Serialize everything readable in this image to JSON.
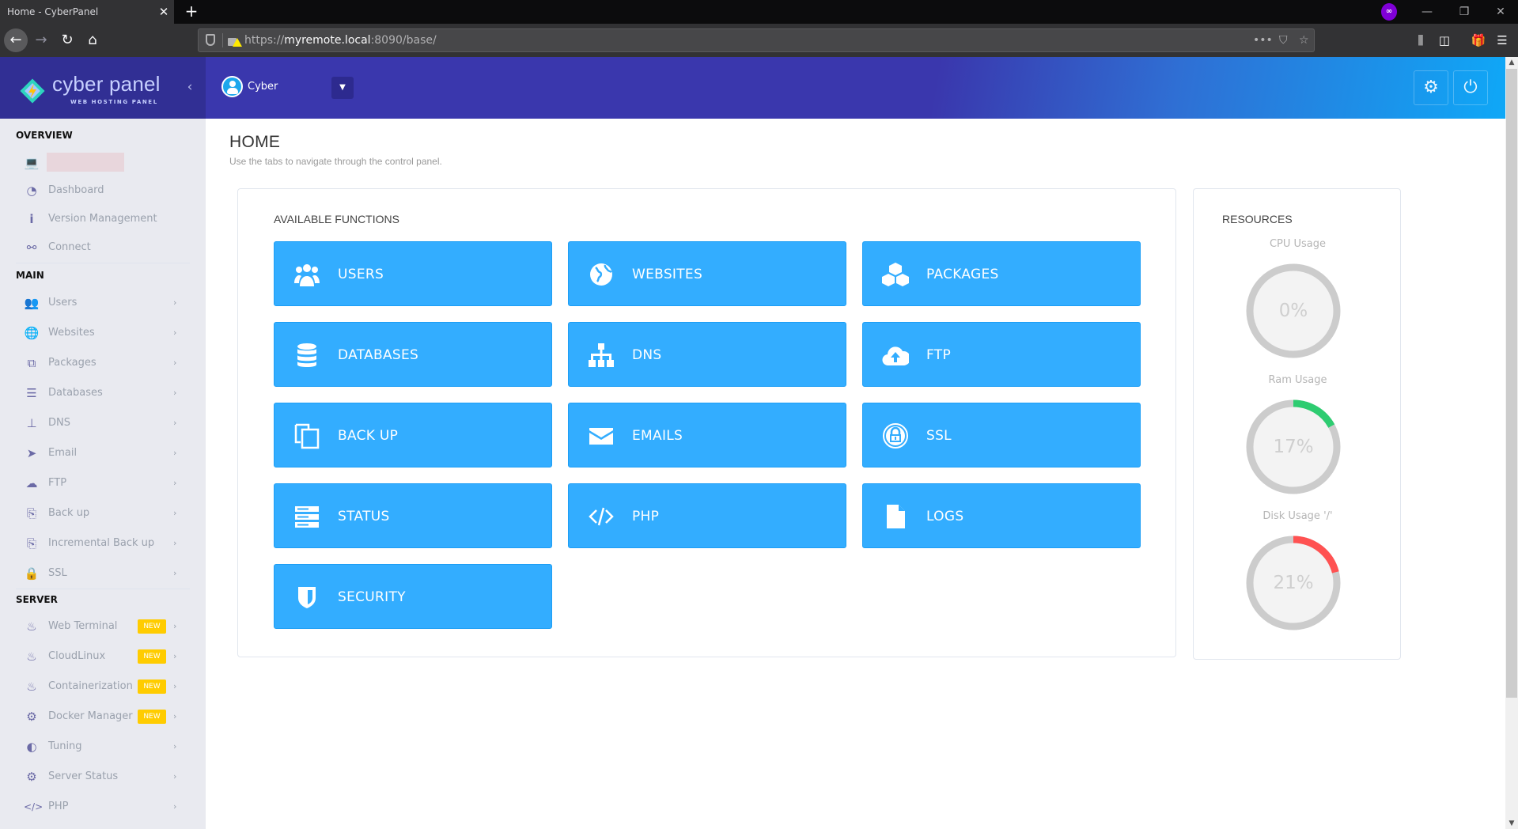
{
  "browser": {
    "tab_title": "Home - CyberPanel",
    "url_prefix": "https://",
    "url_host": "myremote.local",
    "url_suffix": ":8090/base/",
    "icons": [
      "back-icon",
      "forward-icon",
      "reload-icon",
      "home-icon",
      "shield-icon",
      "lock-warning-icon",
      "more-icon",
      "pocket-icon",
      "star-icon",
      "library-icon",
      "sidebar-icon",
      "gift-icon",
      "menu-icon"
    ]
  },
  "header": {
    "logo_text": "cyber panel",
    "logo_sub": "WEB HOSTING PANEL",
    "user_name": "Cyber"
  },
  "sidebar": {
    "sections": [
      {
        "title": "OVERVIEW"
      },
      {
        "title": "MAIN"
      },
      {
        "title": "SERVER"
      }
    ],
    "overview": [
      {
        "label": "",
        "icon": "laptop-icon",
        "redacted": true
      },
      {
        "label": "Dashboard",
        "icon": "dashboard-icon"
      },
      {
        "label": "Version Management",
        "icon": "info-icon"
      },
      {
        "label": "Connect",
        "icon": "link-icon"
      }
    ],
    "main": [
      {
        "label": "Users",
        "icon": "users-icon"
      },
      {
        "label": "Websites",
        "icon": "globe-icon"
      },
      {
        "label": "Packages",
        "icon": "cubes-icon"
      },
      {
        "label": "Databases",
        "icon": "database-icon"
      },
      {
        "label": "DNS",
        "icon": "sitemap-icon"
      },
      {
        "label": "Email",
        "icon": "paper-plane-icon"
      },
      {
        "label": "FTP",
        "icon": "cloud-upload-icon"
      },
      {
        "label": "Back up",
        "icon": "copy-icon"
      },
      {
        "label": "Incremental Back up",
        "icon": "copy-icon"
      },
      {
        "label": "SSL",
        "icon": "lock-icon"
      }
    ],
    "server": [
      {
        "label": "Web Terminal",
        "icon": "fire-icon",
        "badge": "NEW"
      },
      {
        "label": "CloudLinux",
        "icon": "fire-icon",
        "badge": "NEW"
      },
      {
        "label": "Containerization",
        "icon": "fire-icon",
        "badge": "NEW"
      },
      {
        "label": "Docker Manager",
        "icon": "cogs-icon",
        "badge": "NEW"
      },
      {
        "label": "Tuning",
        "icon": "adjust-icon"
      },
      {
        "label": "Server Status",
        "icon": "gear-icon"
      },
      {
        "label": "PHP",
        "icon": "code-icon"
      }
    ]
  },
  "page": {
    "title": "HOME",
    "subtitle": "Use the tabs to navigate through the control panel."
  },
  "functions": {
    "title": "AVAILABLE FUNCTIONS",
    "items": [
      {
        "label": "USERS",
        "icon": "users-icon"
      },
      {
        "label": "WEBSITES",
        "icon": "globe-icon"
      },
      {
        "label": "PACKAGES",
        "icon": "cubes-icon"
      },
      {
        "label": "DATABASES",
        "icon": "database-icon"
      },
      {
        "label": "DNS",
        "icon": "sitemap-icon"
      },
      {
        "label": "FTP",
        "icon": "cloud-upload-icon"
      },
      {
        "label": "BACK UP",
        "icon": "copy-icon"
      },
      {
        "label": "EMAILS",
        "icon": "envelope-icon"
      },
      {
        "label": "SSL",
        "icon": "lock-circle-icon"
      },
      {
        "label": "STATUS",
        "icon": "server-icon"
      },
      {
        "label": "PHP",
        "icon": "code-icon"
      },
      {
        "label": "LOGS",
        "icon": "file-icon"
      },
      {
        "label": "SECURITY",
        "icon": "shield-icon"
      }
    ]
  },
  "resources": {
    "title": "RESOURCES",
    "gauges": [
      {
        "label": "CPU Usage",
        "value": 0,
        "display": "0%",
        "color": "#2ecc71"
      },
      {
        "label": "Ram Usage",
        "value": 17,
        "display": "17%",
        "color": "#2ecc71"
      },
      {
        "label": "Disk Usage '/'",
        "value": 21,
        "display": "21%",
        "color": "#ff5252"
      }
    ]
  },
  "colors": {
    "accent": "#33adff",
    "header": "#3a37ad",
    "brand": "#312f94",
    "badge": "#ffcc00",
    "sidebar_bg": "#e9eaf0",
    "sidebar_icon": "#6b6aa6"
  }
}
